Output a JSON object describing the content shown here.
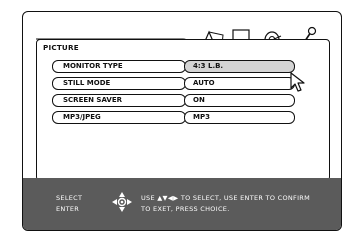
{
  "menu": {
    "title": "PICTURE",
    "tabs": [
      {
        "icon": "picture-icon"
      },
      {
        "icon": "language-icon"
      },
      {
        "icon": "audio-icon"
      },
      {
        "icon": "setup-icon"
      }
    ],
    "items": [
      {
        "label": "MONITOR TYPE",
        "value": "4:3 L.B.",
        "selected": true
      },
      {
        "label": "STILL MODE",
        "value": "AUTO"
      },
      {
        "label": "SCREEN SAVER",
        "value": "ON"
      },
      {
        "label": "MP3/JPEG",
        "value": "MP3"
      }
    ]
  },
  "footer": {
    "select_label": "SELECT",
    "enter_label": "ENTER",
    "instruction_line1": "USE ▲▼◀▶ TO SELECT, USE ENTER TO CONFIRM",
    "instruction_line2": "TO EXET, PRESS CHOICE."
  },
  "colors": {
    "footer_bg": "#5b5b5b",
    "selected_value_bg": "#d4d4d4",
    "outline": "#111111"
  }
}
